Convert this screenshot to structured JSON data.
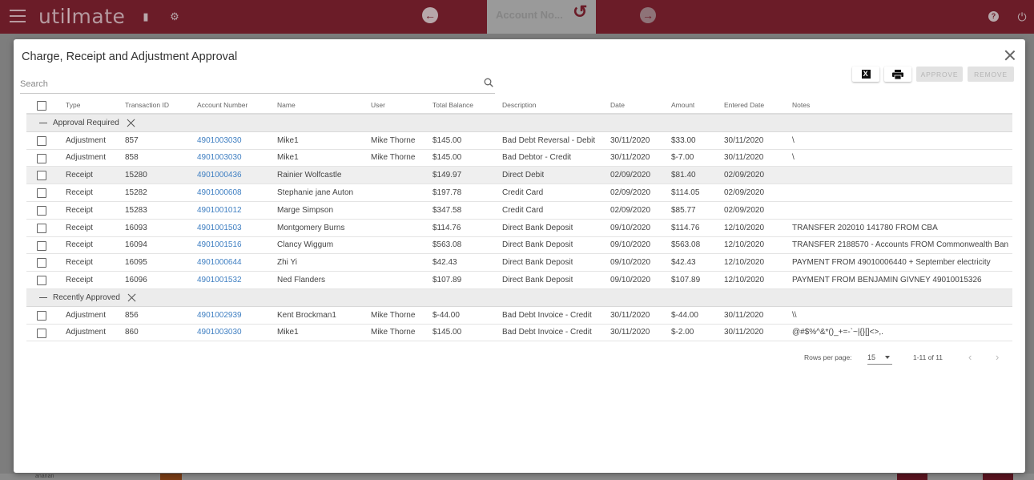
{
  "appbar": {
    "logo_part1": "uti",
    "logo_part2": "l",
    "logo_part3": "mate",
    "account_field": "Account No...",
    "icons": [
      "menu-icon",
      "book-icon",
      "gears-icon",
      "back-arrow-icon",
      "refresh-icon",
      "forward-arrow-icon",
      "help-icon",
      "power-icon"
    ]
  },
  "dialog": {
    "title": "Charge, Receipt and Adjustment Approval",
    "search_placeholder": "Search",
    "search_value": "",
    "toolbar": {
      "excel_label": "X",
      "approve_label": "APPROVE",
      "remove_label": "REMOVE"
    },
    "columns": [
      "Type",
      "Transaction ID",
      "Account Number",
      "Name",
      "User",
      "Total Balance",
      "Description",
      "Date",
      "Amount",
      "Entered Date",
      "Notes"
    ],
    "groups": [
      {
        "label": "Approval Required",
        "rows": [
          {
            "type": "Adjustment",
            "tid": "857",
            "acct": "4901003030",
            "name": "Mike1",
            "user": "Mike Thorne",
            "bal": "$145.00",
            "desc": "Bad Debt Reversal - Debit",
            "date": "30/11/2020",
            "amt": "$33.00",
            "edate": "30/11/2020",
            "notes": "\\"
          },
          {
            "type": "Adjustment",
            "tid": "858",
            "acct": "4901003030",
            "name": "Mike1",
            "user": "Mike Thorne",
            "bal": "$145.00",
            "desc": "Bad Debtor - Credit",
            "date": "30/11/2020",
            "amt": "$-7.00",
            "edate": "30/11/2020",
            "notes": "\\"
          },
          {
            "type": "Receipt",
            "tid": "15280",
            "acct": "4901000436",
            "name": "Rainier Wolfcastle",
            "user": "",
            "bal": "$149.97",
            "desc": "Direct Debit",
            "date": "02/09/2020",
            "amt": "$81.40",
            "edate": "02/09/2020",
            "notes": ""
          },
          {
            "type": "Receipt",
            "tid": "15282",
            "acct": "4901000608",
            "name": "Stephanie jane Auton",
            "user": "",
            "bal": "$197.78",
            "desc": "Credit Card",
            "date": "02/09/2020",
            "amt": "$114.05",
            "edate": "02/09/2020",
            "notes": ""
          },
          {
            "type": "Receipt",
            "tid": "15283",
            "acct": "4901001012",
            "name": "Marge Simpson",
            "user": "",
            "bal": "$347.58",
            "desc": "Credit Card",
            "date": "02/09/2020",
            "amt": "$85.77",
            "edate": "02/09/2020",
            "notes": ""
          },
          {
            "type": "Receipt",
            "tid": "16093",
            "acct": "4901001503",
            "name": "Montgomery Burns",
            "user": "",
            "bal": "$114.76",
            "desc": "Direct Bank Deposit",
            "date": "09/10/2020",
            "amt": "$114.76",
            "edate": "12/10/2020",
            "notes": "TRANSFER 202010 141780 FROM CBA"
          },
          {
            "type": "Receipt",
            "tid": "16094",
            "acct": "4901001516",
            "name": "Clancy Wiggum",
            "user": "",
            "bal": "$563.08",
            "desc": "Direct Bank Deposit",
            "date": "09/10/2020",
            "amt": "$563.08",
            "edate": "12/10/2020",
            "notes": "TRANSFER 2188570 - Accounts FROM Commonwealth Ban"
          },
          {
            "type": "Receipt",
            "tid": "16095",
            "acct": "4901000644",
            "name": "Zhi Yi",
            "user": "",
            "bal": "$42.43",
            "desc": "Direct Bank Deposit",
            "date": "09/10/2020",
            "amt": "$42.43",
            "edate": "12/10/2020",
            "notes": "PAYMENT FROM 49010006440 + September electricity"
          },
          {
            "type": "Receipt",
            "tid": "16096",
            "acct": "4901001532",
            "name": "Ned Flanders",
            "user": "",
            "bal": "$107.89",
            "desc": "Direct Bank Deposit",
            "date": "09/10/2020",
            "amt": "$107.89",
            "edate": "12/10/2020",
            "notes": "PAYMENT FROM BENJAMIN GIVNEY 49010015326"
          }
        ]
      },
      {
        "label": "Recently Approved",
        "rows": [
          {
            "type": "Adjustment",
            "tid": "856",
            "acct": "4901002939",
            "name": "Kent Brockman1",
            "user": "Mike Thorne",
            "bal": "$-44.00",
            "desc": "Bad Debt Invoice - Credit",
            "date": "30/11/2020",
            "amt": "$-44.00",
            "edate": "30/11/2020",
            "notes": "\\\\"
          },
          {
            "type": "Adjustment",
            "tid": "860",
            "acct": "4901003030",
            "name": "Mike1",
            "user": "Mike Thorne",
            "bal": "$145.00",
            "desc": "Bad Debt Invoice - Credit",
            "date": "30/11/2020",
            "amt": "$-2.00",
            "edate": "30/11/2020",
            "notes": "@#$%^&*()_+=-`~|{}[]<>,."
          }
        ]
      }
    ],
    "pagination": {
      "rows_per_page_label": "Rows per page:",
      "rows_per_page_value": "15",
      "range": "1-11 of 11",
      "prev": "‹",
      "next": "›"
    }
  },
  "background": {
    "fragment_text": "ananan"
  },
  "colors": {
    "brand": "#7a1e2c",
    "link": "#3f7fc2"
  }
}
